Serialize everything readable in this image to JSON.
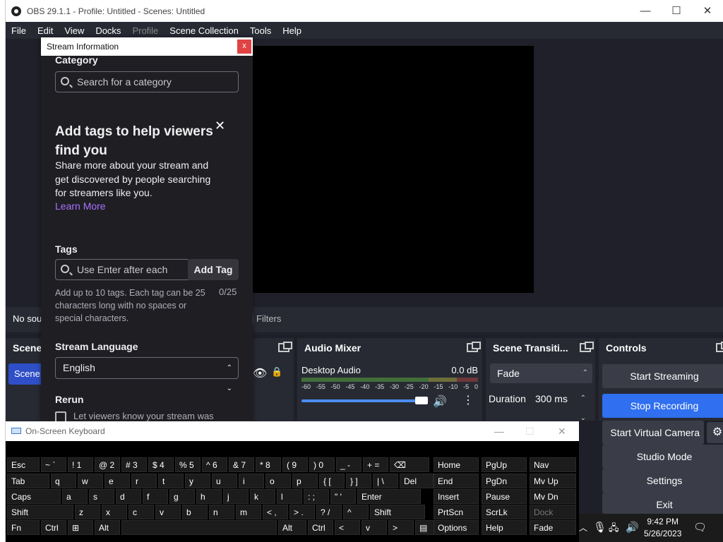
{
  "window": {
    "title": "OBS 29.1.1 - Profile: Untitled - Scenes: Untitled"
  },
  "menu": [
    "File",
    "Edit",
    "View",
    "Docks",
    "Profile",
    "Scene Collection",
    "Tools",
    "Help"
  ],
  "sources_bar": {
    "no_source": "No sou",
    "filters": "Filters"
  },
  "docks": {
    "scenes_title": "Scene",
    "scene_item": "Scene",
    "mixer_title": "Audio Mixer",
    "mixer_channel": "Desktop Audio",
    "mixer_db": "0.0 dB",
    "mixer_scale": [
      "-60",
      "-55",
      "-50",
      "-45",
      "-40",
      "-35",
      "-30",
      "-25",
      "-20",
      "-15",
      "-10",
      "-5",
      "0"
    ],
    "mixer_volume_level": 1.0,
    "trans_title": "Scene Transiti...",
    "trans_type": "Fade",
    "trans_duration_label": "Duration",
    "trans_duration": "300 ms",
    "controls_title": "Controls",
    "controls": [
      "Start Streaming",
      "Stop Recording",
      "Start Virtual Camera",
      "Studio Mode",
      "Settings",
      "Exit"
    ]
  },
  "popup": {
    "title": "Stream Information",
    "close": "x",
    "category_label": "Category",
    "category_placeholder": "Search for a category",
    "promo_title": "Add tags to help viewers find you",
    "promo_text": "Share more about your stream and get discovered by people searching for streamers like you.",
    "learn_more": "Learn More",
    "tags_label": "Tags",
    "tags_placeholder": "Use Enter after each",
    "add_tag": "Add Tag",
    "tags_help": "Add up to 10 tags. Each tag can be 25 characters long with no spaces or special characters.",
    "tags_count": "0/25",
    "language_label": "Stream Language",
    "language_value": "English",
    "rerun_label": "Rerun",
    "rerun_text": "Let viewers know your stream was"
  },
  "osk": {
    "title": "On-Screen Keyboard",
    "rows": [
      [
        "Esc",
        "~ `",
        "! 1",
        "@ 2",
        "# 3",
        "$ 4",
        "% 5",
        "^ 6",
        "& 7",
        "* 8",
        "( 9",
        ") 0",
        "_ -",
        "+ =",
        "⌫"
      ],
      [
        "Tab",
        "q",
        "w",
        "e",
        "r",
        "t",
        "y",
        "u",
        "i",
        "o",
        "p",
        "{ [",
        "} ]",
        "| \\",
        "Del"
      ],
      [
        "Caps",
        "a",
        "s",
        "d",
        "f",
        "g",
        "h",
        "j",
        "k",
        "l",
        ": ;",
        "\" '",
        "Enter"
      ],
      [
        "Shift",
        "z",
        "x",
        "c",
        "v",
        "b",
        "n",
        "m",
        "< ,",
        "> .",
        "? /",
        "^",
        "Shift"
      ],
      [
        "Fn",
        "Ctrl",
        "⊞",
        "Alt",
        "",
        "Alt",
        "Ctrl",
        "<",
        "v",
        ">",
        "▤"
      ]
    ],
    "nav": [
      [
        "Home",
        "PgUp",
        "Nav"
      ],
      [
        "End",
        "PgDn",
        "Mv Up"
      ],
      [
        "Insert",
        "Pause",
        "Mv Dn"
      ],
      [
        "PrtScn",
        "ScrLk",
        "Dock"
      ],
      [
        "Options",
        "Help",
        "Fade"
      ]
    ]
  },
  "taskbar": {
    "time": "9:42 PM",
    "date": "5/26/2023"
  }
}
